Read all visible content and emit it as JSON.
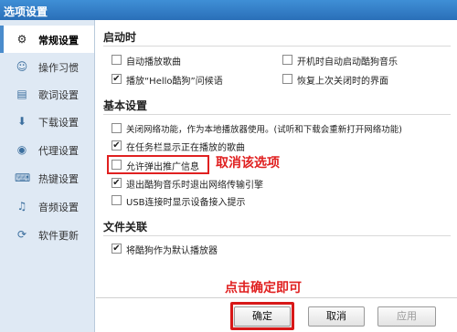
{
  "window": {
    "title": "选项设置"
  },
  "sidebar": {
    "items": [
      {
        "label": "常规设置",
        "icon": "gear-icon",
        "glyph": "⚙",
        "active": true
      },
      {
        "label": "操作习惯",
        "icon": "person-icon",
        "glyph": "☺"
      },
      {
        "label": "歌词设置",
        "icon": "lyrics-icon",
        "glyph": "▤"
      },
      {
        "label": "下载设置",
        "icon": "download-icon",
        "glyph": "⬇"
      },
      {
        "label": "代理设置",
        "icon": "proxy-icon",
        "glyph": "◉"
      },
      {
        "label": "热键设置",
        "icon": "keyboard-icon",
        "glyph": "⌨"
      },
      {
        "label": "音频设置",
        "icon": "audio-icon",
        "glyph": "♫"
      },
      {
        "label": "软件更新",
        "icon": "update-icon",
        "glyph": "⟳"
      }
    ]
  },
  "sections": {
    "startup": {
      "title": "启动时",
      "options": [
        {
          "label": "自动播放歌曲",
          "checked": false
        },
        {
          "label": "开机时自动启动酷狗音乐",
          "checked": false
        },
        {
          "label": "播放“Hello酷狗”问候语",
          "checked": true
        },
        {
          "label": "恢复上次关闭时的界面",
          "checked": false
        }
      ]
    },
    "basic": {
      "title": "基本设置",
      "options": [
        {
          "label": "关闭网络功能，作为本地播放器使用。(试听和下载会重新打开网络功能)",
          "checked": false
        },
        {
          "label": "在任务栏显示正在播放的歌曲",
          "checked": true
        },
        {
          "label": "允许弹出推广信息",
          "checked": false
        },
        {
          "label": "退出酷狗音乐时退出网络传输引擎",
          "checked": true
        },
        {
          "label": "USB连接时显示设备接入提示",
          "checked": false
        }
      ]
    },
    "file_assoc": {
      "title": "文件关联",
      "options": [
        {
          "label": "将酷狗作为默认播放器",
          "checked": true
        }
      ]
    }
  },
  "annotations": {
    "cancel_option": "取消该选项",
    "click_ok": "点击确定即可"
  },
  "buttons": {
    "ok": "确定",
    "cancel": "取消",
    "apply": "应用"
  },
  "colors": {
    "annotation_red": "#e02020",
    "titlebar_blue": "#2a6fb8",
    "sidebar_bg": "#dfe9f4"
  }
}
